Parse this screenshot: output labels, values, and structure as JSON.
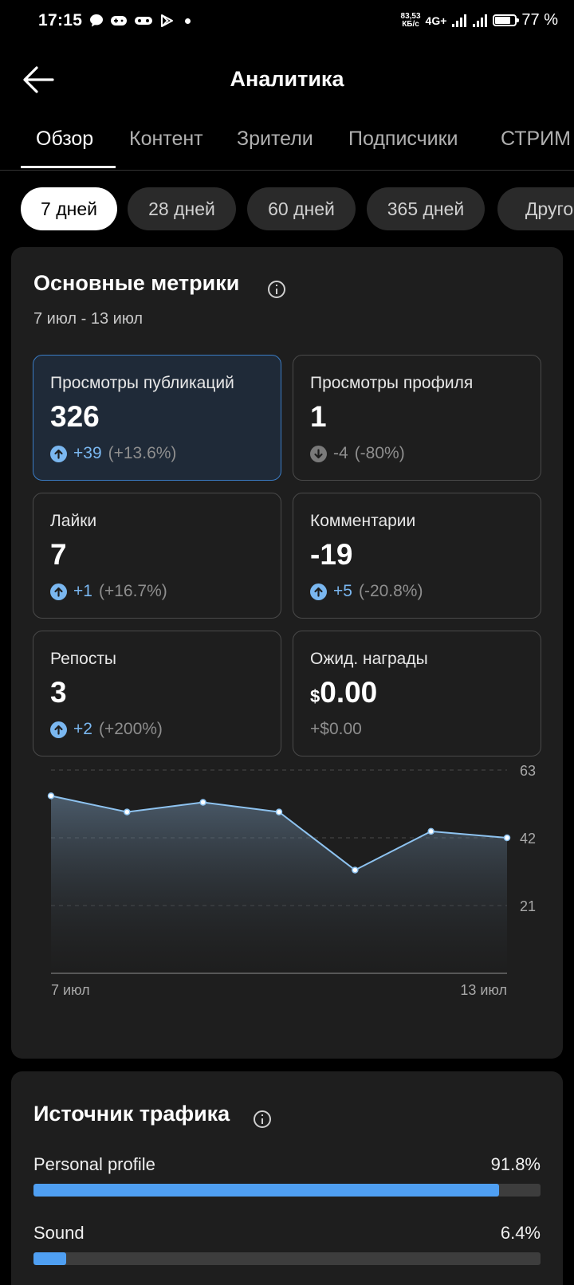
{
  "status_bar": {
    "time": "17:15",
    "net_speed_value": "83,53",
    "net_speed_unit": "КБ/с",
    "network": "4G+",
    "battery": "77 %"
  },
  "header": {
    "title": "Аналитика"
  },
  "tabs": [
    {
      "label": "Обзор",
      "active": true
    },
    {
      "label": "Контент"
    },
    {
      "label": "Зрители"
    },
    {
      "label": "Подписчики"
    },
    {
      "label": "СТРИМ"
    }
  ],
  "periods": [
    {
      "label": "7 дней",
      "active": true
    },
    {
      "label": "28 дней"
    },
    {
      "label": "60 дней"
    },
    {
      "label": "365 дней"
    },
    {
      "label": "Друго"
    }
  ],
  "metrics": {
    "title": "Основные метрики",
    "date_range": "7 июл - 13 июл",
    "items": [
      {
        "label": "Просмотры публикаций",
        "value": "326",
        "delta": "+39",
        "pct": "(+13.6%)",
        "direction": "up"
      },
      {
        "label": "Просмотры профиля",
        "value": "1",
        "delta": "-4",
        "pct": "(-80%)",
        "direction": "down"
      },
      {
        "label": "Лайки",
        "value": "7",
        "delta": "+1",
        "pct": "(+16.7%)",
        "direction": "up"
      },
      {
        "label": "Комментарии",
        "value": "-19",
        "delta": "+5",
        "pct": "(-20.8%)",
        "direction": "up"
      },
      {
        "label": "Репосты",
        "value": "3",
        "delta": "+2",
        "pct": "(+200%)",
        "direction": "up"
      },
      {
        "label": "Ожид. награды",
        "currency": "$",
        "value": "0.00",
        "delta": "+$0.00",
        "direction": "none"
      }
    ]
  },
  "chart_data": {
    "type": "area",
    "x_labels": [
      "7 июл",
      "13 июл"
    ],
    "x": [
      "7 июл",
      "8 июл",
      "9 июл",
      "10 июл",
      "11 июл",
      "12 июл",
      "13 июл"
    ],
    "values": [
      55,
      50,
      53,
      50,
      32,
      44,
      42
    ],
    "y_ticks": [
      21,
      42,
      63
    ],
    "ylim": [
      0,
      63
    ],
    "color": "#8ec3f0",
    "grid": true
  },
  "traffic": {
    "title": "Источник трафика",
    "sources": [
      {
        "name": "Personal profile",
        "pct_label": "91.8%",
        "fraction": 0.918
      },
      {
        "name": "Sound",
        "pct_label": "6.4%",
        "fraction": 0.064
      }
    ]
  }
}
